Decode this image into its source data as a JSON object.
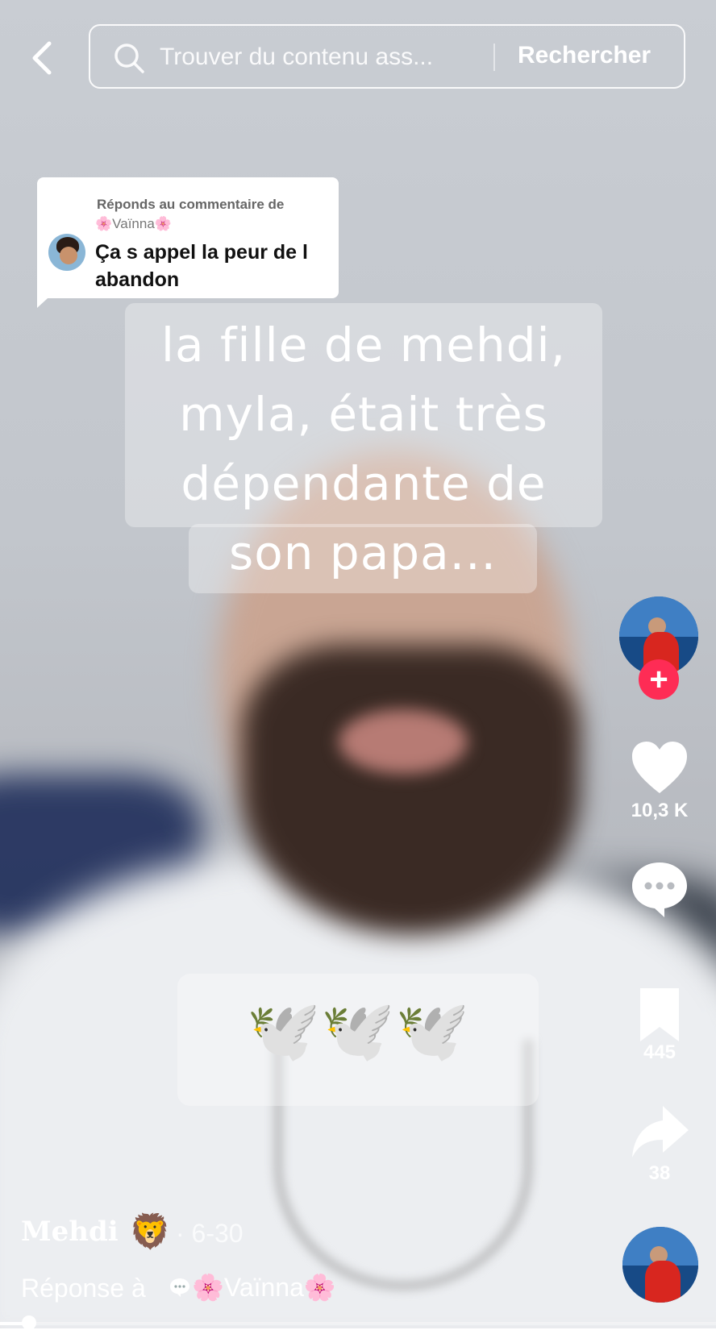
{
  "search": {
    "placeholder": "Trouver du contenu ass...",
    "button_label": "Rechercher"
  },
  "reply_card": {
    "heading": "Réponds au commentaire de",
    "user": "🌸Vaïnna🌸",
    "comment": "Ça s appel la peur de l abandon"
  },
  "caption": {
    "lines": [
      "la fille de mehdi,",
      "myla, était très",
      "dépendante de",
      "son papa..."
    ],
    "emoji_line": "🕊️🕊️🕊️"
  },
  "actions": {
    "likes": "10,3 K",
    "saves": "445",
    "shares": "38",
    "follow_symbol": "+"
  },
  "post": {
    "author": "Mehdi",
    "author_emoji": "🦁",
    "date": "· 6-30",
    "reply_prefix": "Réponse à",
    "reply_to": "🌸Vaïnna🌸"
  },
  "playback": {
    "progress_fraction": 0.04
  },
  "colors": {
    "follow_accent": "#fe2c55",
    "reply_card_bg": "#ffffff"
  },
  "icons": {
    "back": "chevron-left-icon",
    "search": "search-icon",
    "like": "heart-icon",
    "comment": "comment-bubble-icon",
    "save": "bookmark-icon",
    "share": "share-arrow-icon"
  }
}
